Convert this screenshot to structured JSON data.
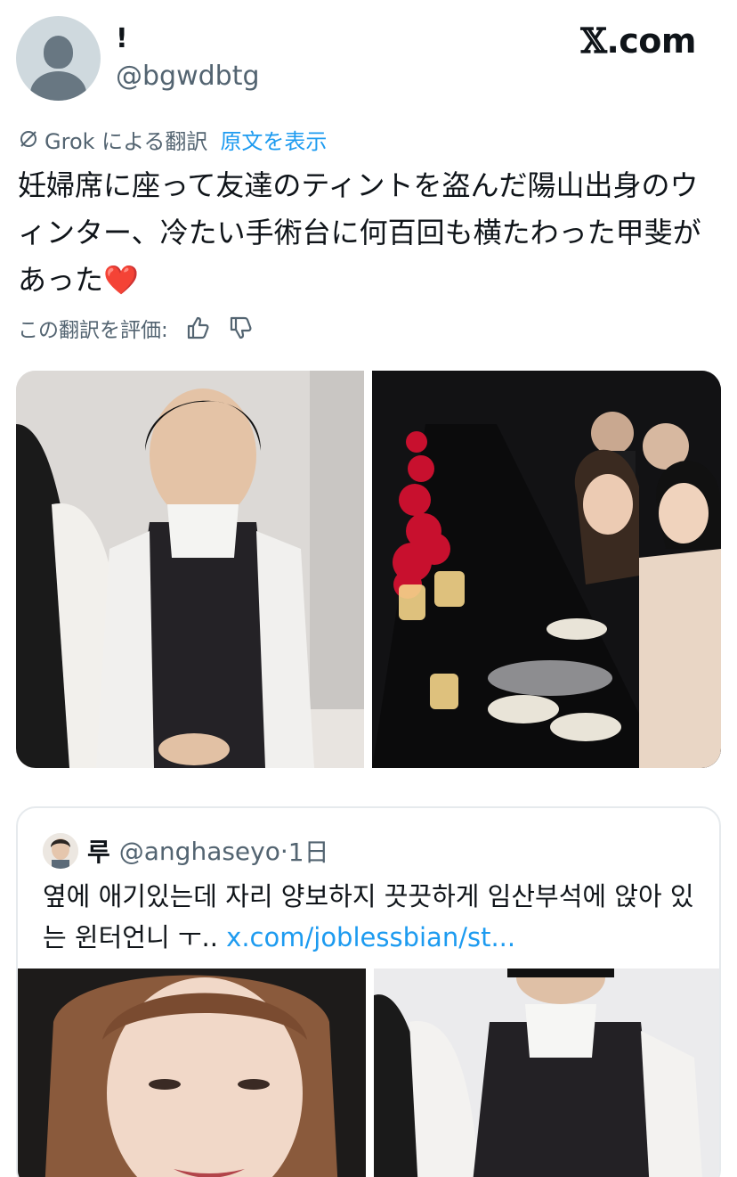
{
  "author": {
    "display_name": "!",
    "handle": "@bgwdbtg",
    "avatar_icon": "default-avatar-icon"
  },
  "brand": {
    "prefix": "𝕏",
    "suffix": ".com"
  },
  "translation": {
    "label": "Grok による翻訳",
    "show_original": "原文を表示",
    "icon": "grok-icon"
  },
  "tweet": {
    "text": "妊婦席に座って友達のティントを盗んだ陽山出身のウィンター、冷たい手術台に何百回も横たわった甲斐があった",
    "emoji": "❤️"
  },
  "rating": {
    "label": "この翻訳を評価:",
    "up_icon": "thumbs-up-icon",
    "down_icon": "thumbs-down-icon"
  },
  "media": [
    {
      "icon": "photo-girl-in-vest"
    },
    {
      "icon": "photo-banquet-table"
    }
  ],
  "quote": {
    "name": "루",
    "handle": "@anghaseyo",
    "separator": "·",
    "time": "1日",
    "text": "옆에 애기있는데 자리 양보하지 끗끗하게 임산부석에 앉아 있는 윈터언니 ㅜ.. ",
    "link": "x.com/joblessbian/st...",
    "media": [
      {
        "icon": "photo-smiling-face"
      },
      {
        "icon": "photo-girl-in-vest-closeup"
      }
    ]
  },
  "colors": {
    "link": "#1d9bf0",
    "secondary_text": "#536471",
    "border": "#e6eaed",
    "heart": "#e0245e"
  }
}
